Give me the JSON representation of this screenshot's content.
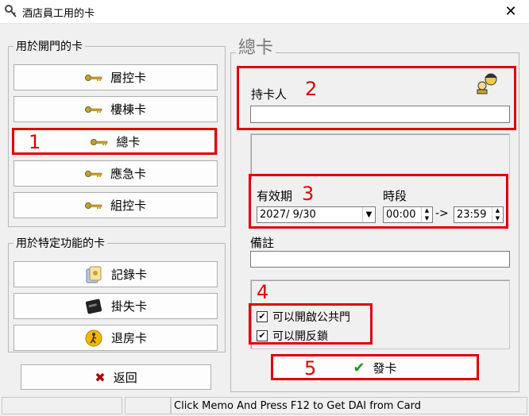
{
  "window": {
    "title": "酒店員工用的卡",
    "close_glyph": "✕"
  },
  "left": {
    "door_group_label": "用於開門的卡",
    "door_buttons": [
      "層控卡",
      "樓棟卡",
      "總卡",
      "應急卡",
      "組控卡"
    ],
    "function_group_label": "用於特定功能的卡",
    "function_buttons": [
      "記錄卡",
      "掛失卡",
      "退房卡"
    ],
    "return_button": "返回",
    "return_icon": "x-icon"
  },
  "right": {
    "section_title": "總卡",
    "holder_label": "持卡人",
    "holder_value": "",
    "validity_label": "有效期",
    "validity_date": "2027/ 9/30",
    "period_label": "時段",
    "time_from": "00:00",
    "arrow": "->",
    "time_to": "23:59",
    "memo_label": "備註",
    "memo_value": "",
    "checks": [
      {
        "label": "可以開啟公共門",
        "checked": true,
        "mark": "✔"
      },
      {
        "label": "可以開反鎖",
        "checked": true,
        "mark": "✔"
      }
    ],
    "issue_button": "發卡"
  },
  "annotations": [
    "1",
    "2",
    "3",
    "4",
    "5"
  ],
  "status_bar": {
    "message": "Click Memo And Press F12 to Get DAI from Card"
  },
  "colors": {
    "annotation_red": "#e00000",
    "issue_check_green": "#1a9a1a",
    "key_gold": "#c9a227"
  }
}
